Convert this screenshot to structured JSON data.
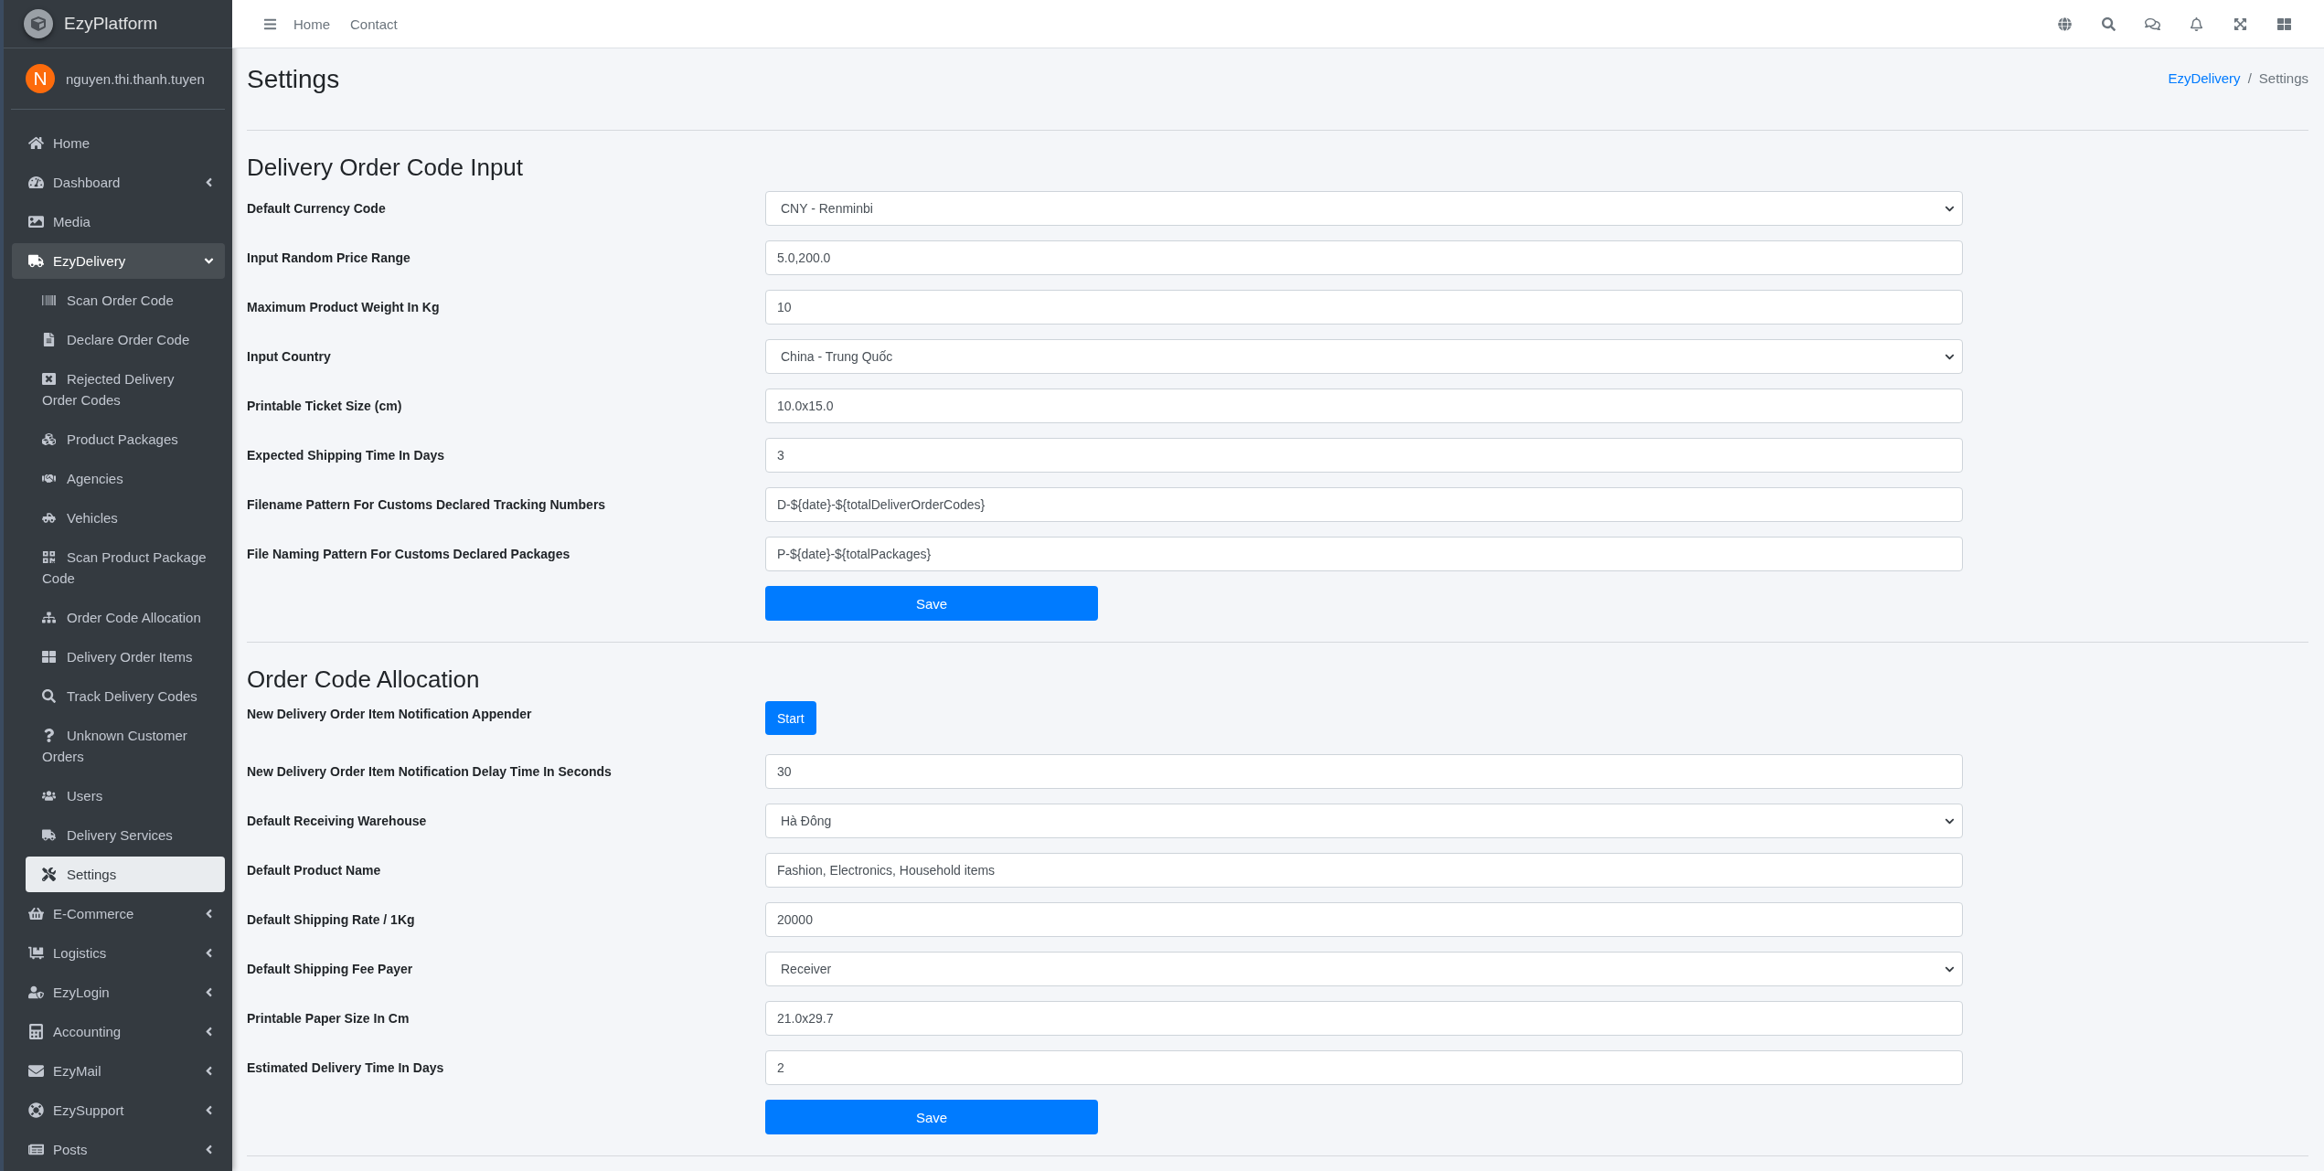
{
  "brand": {
    "name": "EzyPlatform"
  },
  "user": {
    "initial": "N",
    "name": "nguyen.thi.thanh.tuyen"
  },
  "sidebar": {
    "items": [
      {
        "label": "Home",
        "selected": false
      },
      {
        "label": "Dashboard",
        "selected": false,
        "expanded": false
      },
      {
        "label": "Media",
        "selected": false
      },
      {
        "label": "EzyDelivery",
        "selected": true,
        "expanded": true,
        "children": [
          {
            "label": "Scan Order Code",
            "selected": false
          },
          {
            "label": "Declare Order Code",
            "selected": false
          },
          {
            "label": "Rejected Delivery Order Codes",
            "selected": false
          },
          {
            "label": "Product Packages",
            "selected": false
          },
          {
            "label": "Agencies",
            "selected": false
          },
          {
            "label": "Vehicles",
            "selected": false
          },
          {
            "label": "Scan Product Package Code",
            "selected": false
          },
          {
            "label": "Order Code Allocation",
            "selected": false
          },
          {
            "label": "Delivery Order Items",
            "selected": false
          },
          {
            "label": "Track Delivery Codes",
            "selected": false
          },
          {
            "label": "Unknown Customer Orders",
            "selected": false
          },
          {
            "label": "Users",
            "selected": false
          },
          {
            "label": "Delivery Services",
            "selected": false
          },
          {
            "label": "Settings",
            "selected": true
          }
        ]
      },
      {
        "label": "E-Commerce",
        "selected": false,
        "expanded": false
      },
      {
        "label": "Logistics",
        "selected": false,
        "expanded": false
      },
      {
        "label": "EzyLogin",
        "selected": false,
        "expanded": false
      },
      {
        "label": "Accounting",
        "selected": false,
        "expanded": false
      },
      {
        "label": "EzyMail",
        "selected": false,
        "expanded": false
      },
      {
        "label": "EzySupport",
        "selected": false,
        "expanded": false
      },
      {
        "label": "Posts",
        "selected": false,
        "expanded": false
      }
    ]
  },
  "topbar": {
    "links": [
      "Home",
      "Contact"
    ]
  },
  "page": {
    "title": "Settings",
    "breadcrumb_separator": "/",
    "breadcrumb": [
      {
        "label": "EzyDelivery",
        "link": true
      },
      {
        "label": "Settings",
        "link": false
      }
    ]
  },
  "sections": [
    {
      "title": "Delivery Order Code Input",
      "save": "Save",
      "fields": [
        {
          "label": "Default Currency Code",
          "kind": "select",
          "value": "CNY - Renminbi"
        },
        {
          "label": "Input Random Price Range",
          "kind": "input",
          "value": "5.0,200.0"
        },
        {
          "label": "Maximum Product Weight In Kg",
          "kind": "input",
          "value": "10"
        },
        {
          "label": "Input Country",
          "kind": "select",
          "value": "China - Trung Quốc"
        },
        {
          "label": "Printable Ticket Size (cm)",
          "kind": "input",
          "value": "10.0x15.0"
        },
        {
          "label": "Expected Shipping Time In Days",
          "kind": "input",
          "value": "3"
        },
        {
          "label": "Filename Pattern For Customs Declared Tracking Numbers",
          "kind": "input",
          "value": "D-${date}-${totalDeliverOrderCodes}"
        },
        {
          "label": "File Naming Pattern For Customs Declared Packages",
          "kind": "input",
          "value": "P-${date}-${totalPackages}"
        }
      ]
    },
    {
      "title": "Order Code Allocation",
      "save": "Save",
      "fields": [
        {
          "label": "New Delivery Order Item Notification Appender",
          "kind": "button",
          "value": "Start"
        },
        {
          "label": "New Delivery Order Item Notification Delay Time In Seconds",
          "kind": "input",
          "value": "30"
        },
        {
          "label": "Default Receiving Warehouse",
          "kind": "select",
          "value": "Hà Đông"
        },
        {
          "label": "Default Product Name",
          "kind": "input",
          "value": "Fashion, Electronics, Household items"
        },
        {
          "label": "Default Shipping Rate / 1Kg",
          "kind": "input",
          "value": "20000"
        },
        {
          "label": "Default Shipping Fee Payer",
          "kind": "select",
          "value": "Receiver"
        },
        {
          "label": "Printable Paper Size In Cm",
          "kind": "input",
          "value": "21.0x29.7"
        },
        {
          "label": "Estimated Delivery Time In Days",
          "kind": "input",
          "value": "2"
        }
      ]
    }
  ]
}
